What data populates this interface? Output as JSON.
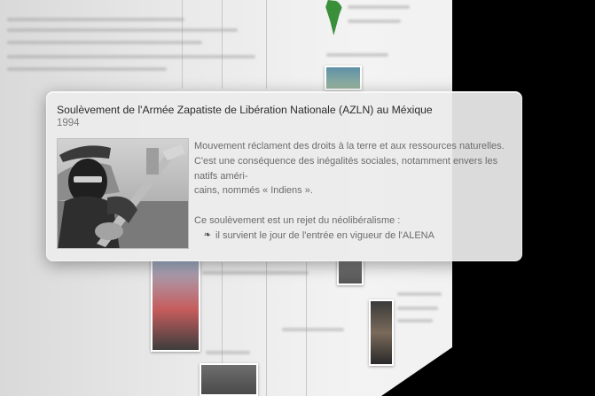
{
  "event": {
    "title": "Soulèvement de l'Armée Zapatiste de Libération Nationale (AZLN) au Méxique",
    "year": "1994",
    "photo_icon": "zapatista-photo",
    "description": {
      "line1": "Mouvement réclament des droits à la terre et aux ressources naturelles.",
      "line2": "C'est une conséquence des inégalités sociales, notamment envers les natifs améri-",
      "line3": "cains, nommés « Indiens ».",
      "line4": "Ce soulèvement est un rejet du néolibéralisme :",
      "bullet": "il survient le jour de l'entrée en vigueur de l'ALENA",
      "bullet_icon": "fleuron-bullet-icon"
    }
  },
  "colors": {
    "card_bg": "#ececec",
    "title": "#2b2b2b",
    "year": "#7a7a7a",
    "body": "#6b6b6b"
  }
}
